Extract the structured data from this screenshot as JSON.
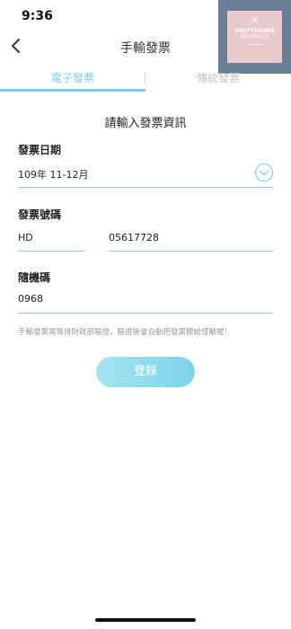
{
  "status_bar": {
    "time": "9:36"
  },
  "watermark": {
    "icon": "x-icon",
    "title": "ONLYYUSUKE",
    "subtitle": "悠悠的簡單生活"
  },
  "nav": {
    "title": "手輸發票",
    "back_icon": "chevron-left-icon"
  },
  "tabs": [
    {
      "label": "電子發票",
      "active": true
    },
    {
      "label": "傳統發票",
      "active": false
    }
  ],
  "form": {
    "heading": "請輸入發票資訊",
    "invoice_date": {
      "label": "發票日期",
      "value": "109年 11-12月",
      "dropdown_icon": "chevron-down-circle-icon"
    },
    "invoice_number": {
      "label": "發票號碼",
      "prefix": "HD",
      "number": "05617728"
    },
    "random_code": {
      "label": "隨機碼",
      "value": "0968"
    },
    "notice": "手輸發票需等待財政部驗證，驗證後會自動把發票餵給怪獸喔！",
    "submit_label": "登錄"
  },
  "colors": {
    "accent": "#7ccde6",
    "inactive_tab": "#c3c3c3",
    "notice": "#9a9a9a"
  }
}
